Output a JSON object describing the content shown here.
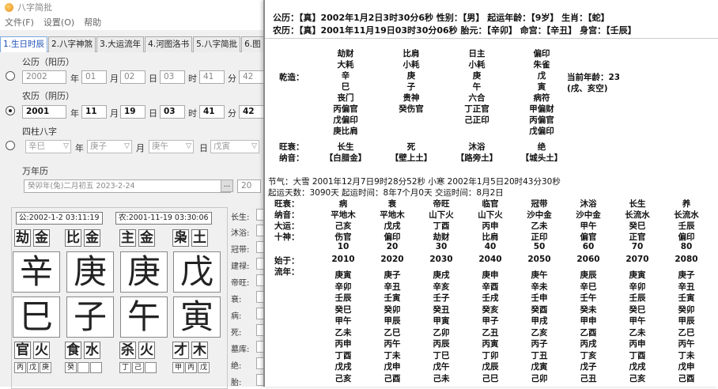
{
  "window": {
    "title": "八字简批"
  },
  "menu": [
    "文件(F)",
    "设置(O)",
    "帮助"
  ],
  "tabs": [
    "1.生日时辰",
    "2.八字神煞",
    "3.大运流年",
    "4.河图洛书",
    "5.八字简批",
    "6.图"
  ],
  "input": {
    "solar_group": "公历（阳历）",
    "solar": {
      "year": "2002",
      "month": "01",
      "day": "02",
      "hour": "03",
      "minute": "41",
      "second": "42"
    },
    "lunar_group": "农历（阴历）",
    "lunar": {
      "year": "2001",
      "month": "11",
      "day": "19",
      "hour": "03",
      "minute": "41",
      "second": "42"
    },
    "pillars_group": "四柱八字",
    "pillars": {
      "year": "辛巳",
      "month": "庚子",
      "day": "庚午",
      "hour": "戊寅"
    },
    "units": {
      "year": "年",
      "month": "月",
      "day": "日",
      "hour": "时",
      "minute": "分"
    },
    "calendar_group": "万年历",
    "calendar_value": "癸卯年(兔)二月初五 2023-2-24",
    "calendar_btn": "...",
    "calendar_num": "20"
  },
  "chart": {
    "solar_time": "公:2002-1-2 03:11:19",
    "lunar_time": "农:2001-11-19 03:30:06",
    "gods_top": [
      [
        "劫",
        "金"
      ],
      [
        "比",
        "金"
      ],
      [
        "主",
        "金"
      ],
      [
        "枭",
        "土"
      ]
    ],
    "stems": [
      "辛",
      "庚",
      "庚",
      "戊"
    ],
    "branches": [
      "巳",
      "子",
      "午",
      "寅"
    ],
    "gods_bottom": [
      [
        "官",
        "火"
      ],
      [
        "食",
        "水"
      ],
      [
        "杀",
        "火"
      ],
      [
        "才",
        "木"
      ]
    ],
    "hidden": [
      [
        "丙",
        "戊",
        "庚"
      ],
      [
        "癸",
        "",
        ""
      ],
      [
        "丁",
        "己",
        ""
      ],
      [
        "甲",
        "丙",
        "戊"
      ]
    ],
    "stages": [
      "长生:",
      "沐浴:",
      "冠带:",
      "建禄:",
      "帝旺:",
      "衰:",
      "病:",
      "死:",
      "墓库:",
      "绝:",
      "胎:"
    ]
  },
  "report": {
    "line1": "公历：【真】2002年1月2日3时30分6秒 性别：【男】 起运年龄：【9岁】 生肖：【蛇】",
    "line2": "农历：【真】2001年11月19日03时30分06秒 胎元：【辛卯】 命宫：【辛丑】 身宫：【壬辰】",
    "qianzao_label": "乾造：",
    "age": "当前年龄：23",
    "void": "(戌、亥空)",
    "pillar_rows": [
      [
        "劫财",
        "比肩",
        "日主",
        "偏印"
      ],
      [
        "大耗",
        "小耗",
        "小耗",
        "朱雀"
      ],
      [
        "辛",
        "庚",
        "庚",
        "戊"
      ],
      [
        "巳",
        "子",
        "午",
        "寅"
      ],
      [
        "丧门",
        "贵神",
        "六合",
        "病符"
      ],
      [
        "丙偏官",
        "癸伤官",
        "丁正官",
        "甲偏财"
      ],
      [
        "戊偏印",
        "",
        "己正印",
        "丙偏官"
      ],
      [
        "庚比肩",
        "",
        "",
        "戊偏印"
      ]
    ],
    "wangshuai_label": "旺衰：",
    "wangshuai": [
      "长生",
      "死",
      "沐浴",
      "绝"
    ],
    "nayin_label": "纳音：",
    "nayin": [
      "【白腊金】",
      "【壁上土】",
      "【路旁土】",
      "【城头土】"
    ],
    "jieqi": "节气：大雪 2001年12月7日9时28分52秒   小寒 2002年1月5日20时43分30秒",
    "qiyun": "起运天数：3090天    起运时间：8年7个月0天     交运时间：8月2日",
    "dayun_labels": [
      "旺衰：",
      "纳音：",
      "大运：",
      "十神：",
      "",
      "始于：",
      "流年："
    ],
    "dayun": {
      "wangshuai": [
        "病",
        "衰",
        "帝旺",
        "临官",
        "冠带",
        "沐浴",
        "长生",
        "养"
      ],
      "nayin": [
        "平地木",
        "平地木",
        "山下火",
        "山下火",
        "沙中金",
        "沙中金",
        "长流水",
        "长流水"
      ],
      "dayun": [
        "己亥",
        "戊戌",
        "丁酉",
        "丙申",
        "乙未",
        "甲午",
        "癸巳",
        "壬辰"
      ],
      "shishen": [
        "伤官",
        "偏印",
        "劫财",
        "比肩",
        "正印",
        "偏官",
        "正官",
        "偏印"
      ],
      "age": [
        "10",
        "20",
        "30",
        "40",
        "50",
        "60",
        "70",
        "80"
      ],
      "start": [
        "2010",
        "2020",
        "2030",
        "2040",
        "2050",
        "2060",
        "2070",
        "2080"
      ],
      "liunian": [
        [
          "庚寅",
          "庚子",
          "庚戌",
          "庚申",
          "庚午",
          "庚辰",
          "庚寅",
          "庚子"
        ],
        [
          "辛卯",
          "辛丑",
          "辛亥",
          "辛酉",
          "辛未",
          "辛巳",
          "辛卯",
          "辛丑"
        ],
        [
          "壬辰",
          "壬寅",
          "壬子",
          "壬戌",
          "壬申",
          "壬午",
          "壬辰",
          "壬寅"
        ],
        [
          "癸巳",
          "癸卯",
          "癸丑",
          "癸亥",
          "癸酉",
          "癸未",
          "癸巳",
          "癸卯"
        ],
        [
          "甲午",
          "甲辰",
          "甲寅",
          "甲子",
          "甲戌",
          "甲申",
          "甲午",
          "甲辰"
        ],
        [
          "乙未",
          "乙巳",
          "乙卯",
          "乙丑",
          "乙亥",
          "乙酉",
          "乙未",
          "乙巳"
        ],
        [
          "丙申",
          "丙午",
          "丙辰",
          "丙寅",
          "丙子",
          "丙戌",
          "丙申",
          "丙午"
        ],
        [
          "丁酉",
          "丁未",
          "丁巳",
          "丁卯",
          "丁丑",
          "丁亥",
          "丁酉",
          "丁未"
        ],
        [
          "戊戌",
          "戊申",
          "戊午",
          "戊辰",
          "戊寅",
          "戊子",
          "戊戌",
          "戊申"
        ],
        [
          "己亥",
          "己酉",
          "己未",
          "己巳",
          "己卯",
          "己丑",
          "己亥",
          "己酉"
        ]
      ]
    }
  }
}
